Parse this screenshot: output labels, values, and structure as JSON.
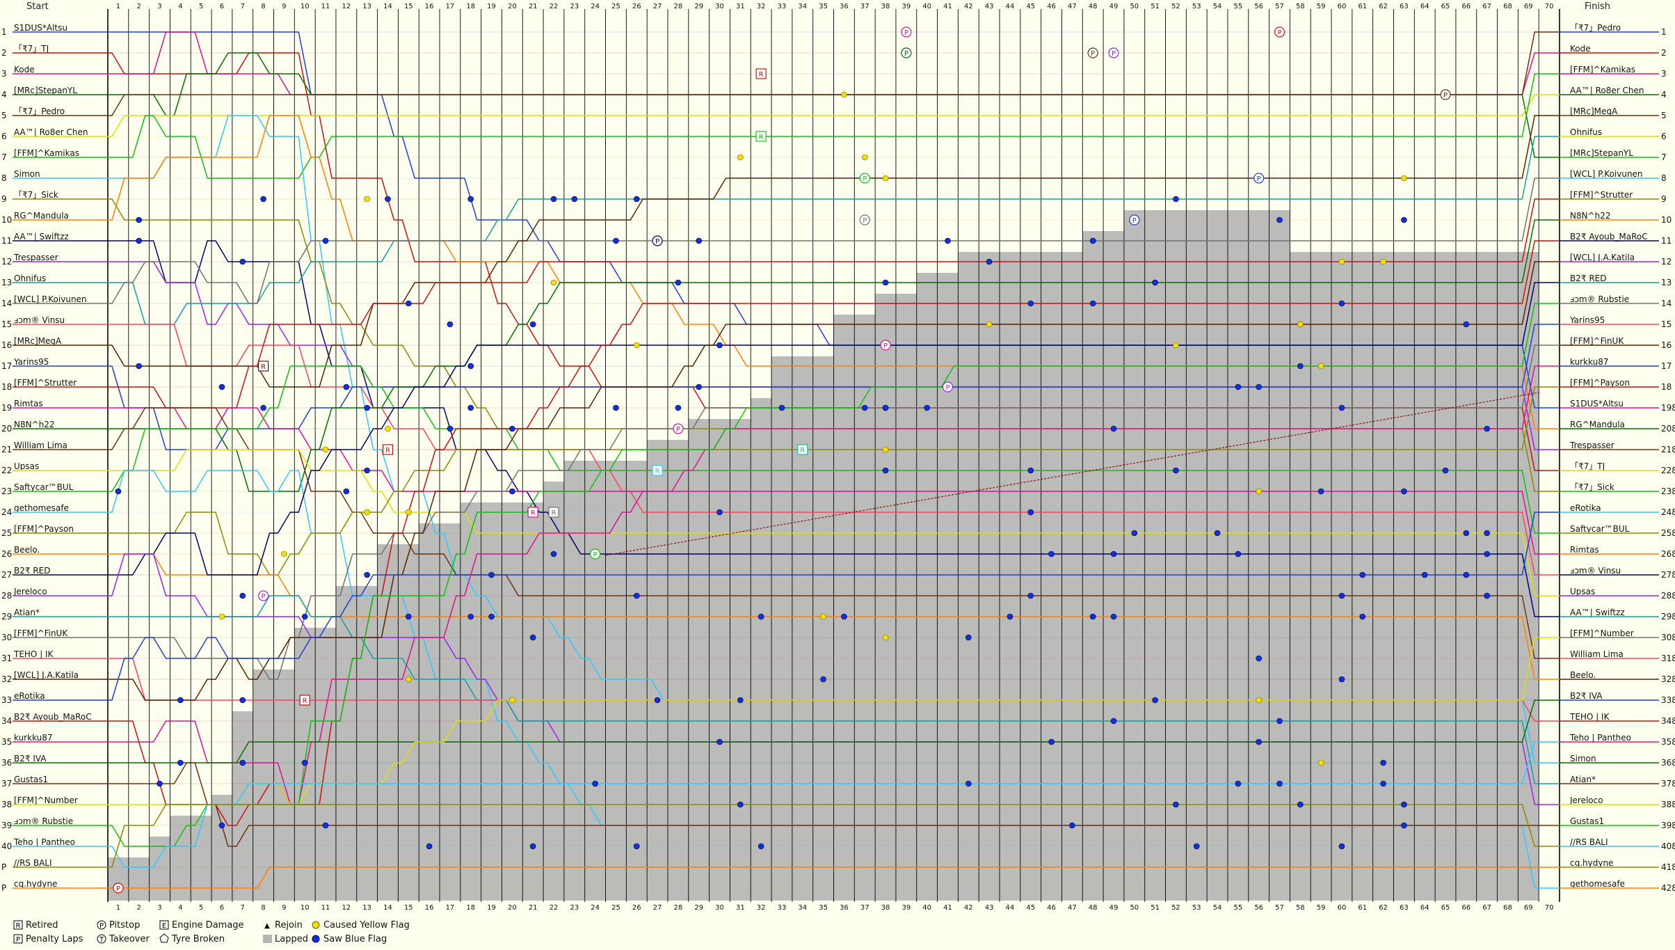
{
  "chart_data": {
    "type": "line",
    "header_left": "Start",
    "header_right": "Finish",
    "laps": 70,
    "start_grid": [
      "S1DUS*Altsu",
      "「₹7」TJ",
      "Kode",
      "[MRc]StepanYL",
      "「₹7」Pedro",
      "AA™| Ro8er Chen",
      "[FFM]^Kamikas",
      "Simon",
      "「₹7」Sick",
      "RG^Mandula",
      "AA™| Swiftzz",
      "Trespasser",
      "Ohnifus",
      "[WCL] P.Koivunen",
      "ⅎↄm® Vinsu",
      "[MRc]MegA",
      "Yarins95",
      "[FFM]^Strutter",
      "Rimtas",
      "N8N^h22",
      "William Lima",
      "Upsas",
      "Saftycar™BUL",
      "gethomesafe",
      "[FFM]^Payson",
      "Beelo.",
      "B2₹ RED",
      "Jereloco",
      "Atian*",
      "[FFM]^FinUK",
      "TEHO | IK",
      "[WCL] J.A.Katila",
      "eRotika",
      "B2₹ Ayoub_MaRoC",
      "kurkku87",
      "B2₹ IVA",
      "Gustas1",
      "[FFM]^Number",
      "ⅎↄm® Rubstie",
      "Teho | Pantheo",
      "//RS BALI",
      "cq.hydyne"
    ],
    "start_positions": [
      "1",
      "2",
      "3",
      "4",
      "5",
      "6",
      "7",
      "8",
      "9",
      "10",
      "11",
      "12",
      "13",
      "14",
      "15",
      "16",
      "17",
      "18",
      "19",
      "20",
      "21",
      "22",
      "23",
      "24",
      "25",
      "26",
      "27",
      "28",
      "29",
      "30",
      "31",
      "32",
      "33",
      "34",
      "35",
      "36",
      "37",
      "38",
      "39",
      "40",
      "P",
      "P"
    ],
    "finish_order": [
      "「₹7」Pedro",
      "Kode",
      "[FFM]^Kamikas",
      "AA™| Ro8er Chen",
      "[MRc]MegA",
      "Ohnifus",
      "[MRc]StepanYL",
      "[WCL] P.Koivunen",
      "[FFM]^Strutter",
      "N8N^h22",
      "B2₹ Ayoub_MaRoC",
      "[WCL] J.A.Katila",
      "B2₹ RED",
      "ⅎↄm® Rubstie",
      "Yarins95",
      "[FFM]^FinUK",
      "kurkku87",
      "[FFM]^Payson",
      "S1DUS*Altsu",
      "RG^Mandula",
      "Trespasser",
      "「₹7」TJ",
      "「₹7」Sick",
      "eRotika",
      "Saftycar™BUL",
      "Rimtas",
      "ⅎↄm® Vinsu",
      "Upsas",
      "AA™| Swiftzz",
      "[FFM]^Number",
      "William Lima",
      "Beelo.",
      "B2₹ IVA",
      "TEHO | IK",
      "Teho | Pantheo",
      "Simon",
      "Atian*",
      "Jereloco",
      "Gustas1",
      "//RS BALI",
      "cq.hydyne",
      "gethomesafe"
    ],
    "finish_positions": [
      "1",
      "2",
      "3",
      "4",
      "5",
      "6",
      "7",
      "8",
      "9",
      "10",
      "11",
      "12",
      "13",
      "14",
      "15",
      "16",
      "17",
      "18",
      "19",
      "20",
      "21",
      "22",
      "23",
      "24",
      "25",
      "26",
      "27",
      "28",
      "29",
      "30",
      "31",
      "32",
      "33",
      "34",
      "35",
      "36",
      "37",
      "38",
      "39",
      "40",
      "41",
      "42"
    ],
    "finish_status_marks": [
      "",
      "",
      "",
      "",
      "",
      "",
      "",
      "",
      "",
      "",
      "",
      "",
      "",
      "",
      "",
      "",
      "",
      "",
      "8",
      "8",
      "8",
      "8",
      "8",
      "8",
      "8",
      "8",
      "8",
      "8",
      "8",
      "8",
      "8",
      "8",
      "8",
      "8",
      "8",
      "8",
      "8",
      "8",
      "8",
      "8",
      "8",
      "8"
    ],
    "colors": [
      "#1f3fd0",
      "#cc1010",
      "#e01090",
      "#007000",
      "#703010",
      "#e0e000",
      "#10c010",
      "#30c8ff",
      "#8a8a00",
      "#ff8000",
      "#000070",
      "#a020f0",
      "#10a0a0",
      "#707070",
      "#ff4060",
      "#5a2000"
    ],
    "lapped_color": "#b4b4b4",
    "legend": [
      {
        "icon": "R",
        "label": "Retired"
      },
      {
        "icon": "P",
        "label": "Pitstop"
      },
      {
        "icon": "E",
        "label": "Engine Damage"
      },
      {
        "icon": "▲",
        "label": "Rejoin"
      },
      {
        "icon": "yellow-dot",
        "label": "Caused Yellow Flag"
      },
      {
        "icon": "P",
        "label": "Penalty Laps"
      },
      {
        "icon": "T",
        "label": "Takeover"
      },
      {
        "icon": "tyre",
        "label": "Tyre Broken"
      },
      {
        "icon": "grey-box",
        "label": "Lapped"
      },
      {
        "icon": "blue-dot",
        "label": "Saw Blue Flag"
      }
    ]
  }
}
